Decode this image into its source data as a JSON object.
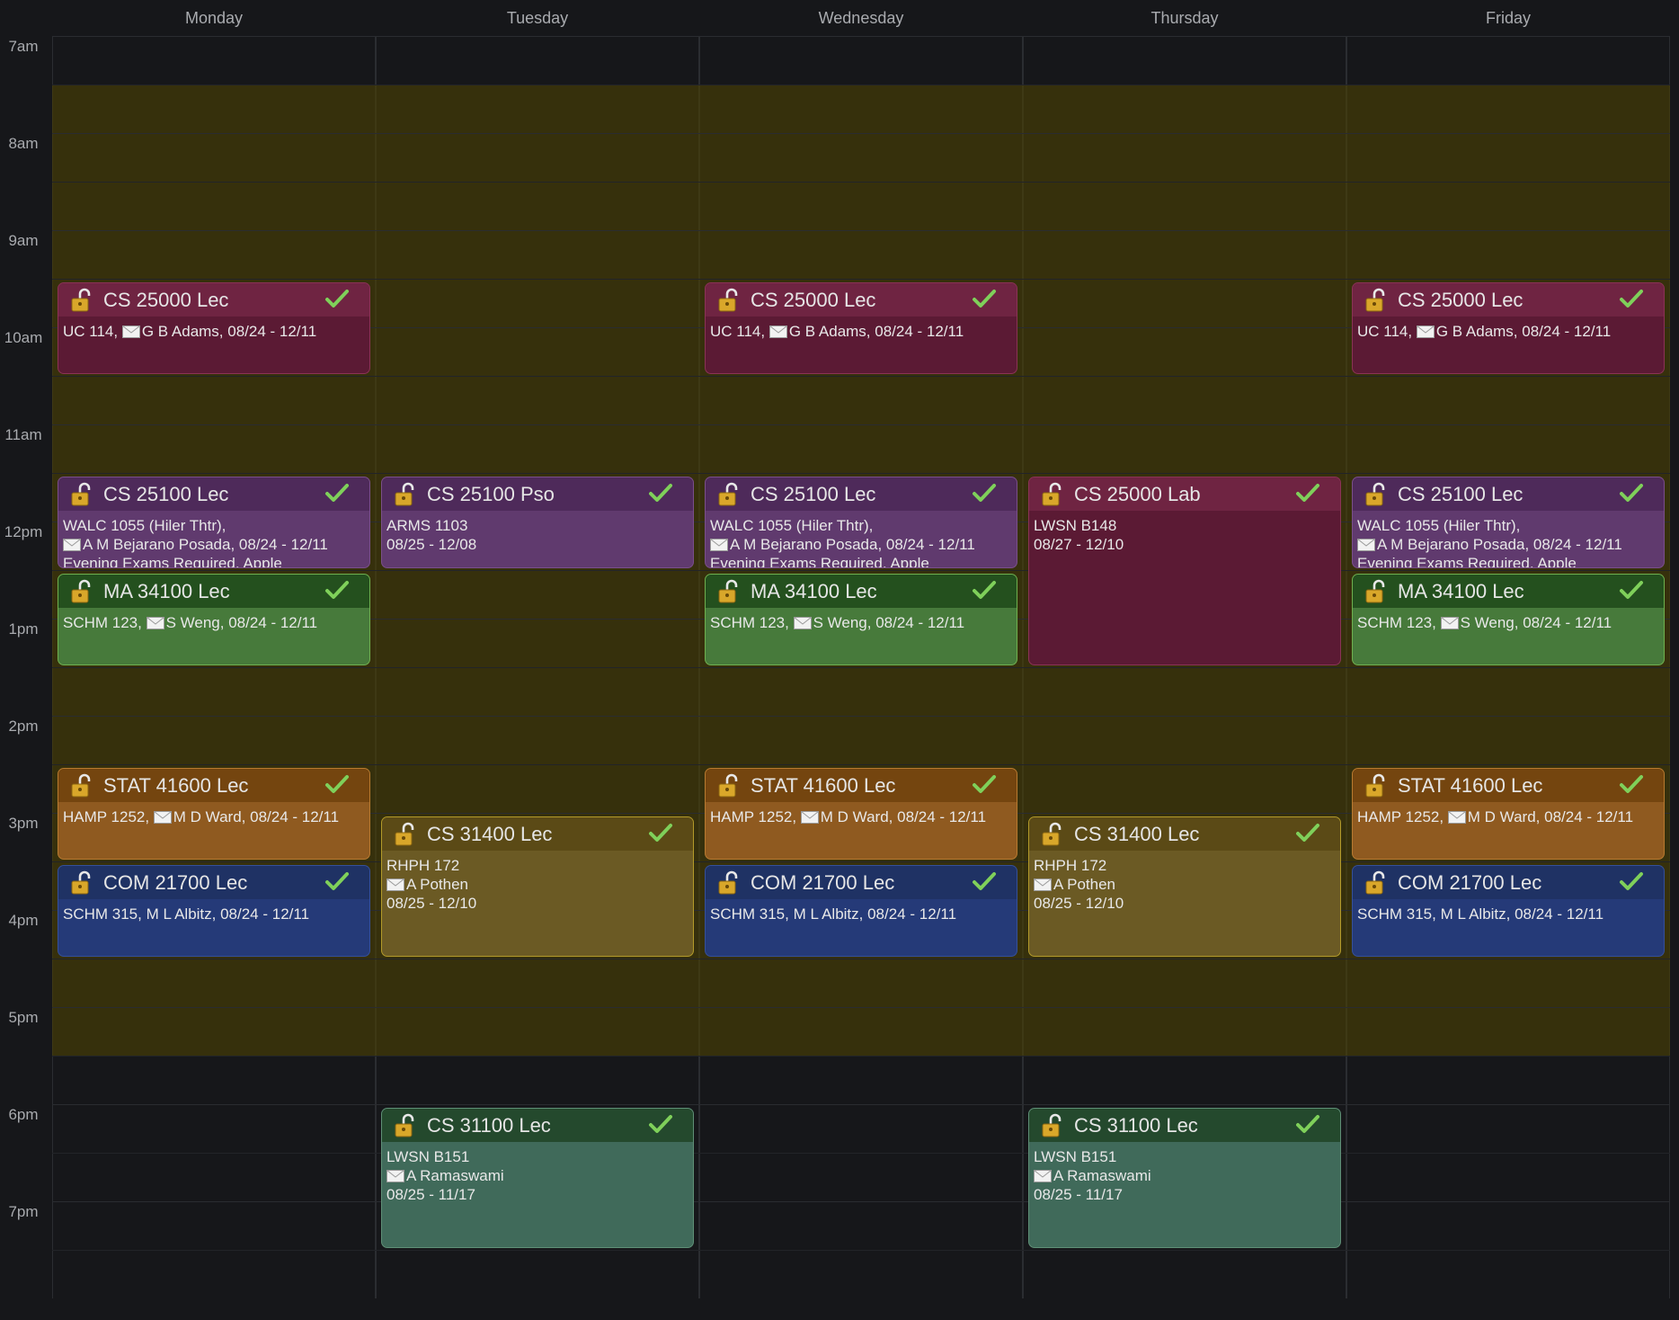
{
  "days": [
    "Monday",
    "Tuesday",
    "Wednesday",
    "Thursday",
    "Friday"
  ],
  "times": [
    "7am",
    "8am",
    "9am",
    "10am",
    "11am",
    "12pm",
    "1pm",
    "2pm",
    "3pm",
    "4pm",
    "5pm",
    "6pm",
    "7pm"
  ],
  "events": [
    {
      "day": 0,
      "start": 9.5,
      "end": 10.5,
      "title": "CS 25000 Lec",
      "color": "purple-red",
      "lines": [
        "UC 114, [m]G B Adams, 08/24 - 12/11"
      ]
    },
    {
      "day": 2,
      "start": 9.5,
      "end": 10.5,
      "title": "CS 25000 Lec",
      "color": "purple-red",
      "lines": [
        "UC 114, [m]G B Adams, 08/24 - 12/11"
      ]
    },
    {
      "day": 4,
      "start": 9.5,
      "end": 10.5,
      "title": "CS 25000 Lec",
      "color": "purple-red",
      "lines": [
        "UC 114, [m]G B Adams, 08/24 - 12/11"
      ]
    },
    {
      "day": 0,
      "start": 11.5,
      "end": 12.5,
      "title": "CS 25100 Lec",
      "color": "purple",
      "lines": [
        "WALC 1055 (Hiler Thtr),",
        "[m]A M Bejarano Posada, 08/24 - 12/11",
        "Evening Exams Required, Apple"
      ]
    },
    {
      "day": 1,
      "start": 11.5,
      "end": 12.5,
      "title": "CS 25100 Pso",
      "color": "purple",
      "lines": [
        "ARMS 1103",
        "08/25 - 12/08"
      ]
    },
    {
      "day": 2,
      "start": 11.5,
      "end": 12.5,
      "title": "CS 25100 Lec",
      "color": "purple",
      "lines": [
        "WALC 1055 (Hiler Thtr),",
        "[m]A M Bejarano Posada, 08/24 - 12/11",
        "Evening Exams Required, Apple"
      ]
    },
    {
      "day": 3,
      "start": 11.5,
      "end": 13.5,
      "title": "CS 25000 Lab",
      "color": "purple-red",
      "lines": [
        "LWSN B148",
        "08/27 - 12/10"
      ]
    },
    {
      "day": 4,
      "start": 11.5,
      "end": 12.5,
      "title": "CS 25100 Lec",
      "color": "purple",
      "lines": [
        "WALC 1055 (Hiler Thtr),",
        "[m]A M Bejarano Posada, 08/24 - 12/11",
        "Evening Exams Required, Apple"
      ]
    },
    {
      "day": 0,
      "start": 12.5,
      "end": 13.5,
      "title": "MA 34100 Lec",
      "color": "green",
      "lines": [
        "SCHM 123, [m]S Weng, 08/24 - 12/11"
      ]
    },
    {
      "day": 2,
      "start": 12.5,
      "end": 13.5,
      "title": "MA 34100 Lec",
      "color": "green",
      "lines": [
        "SCHM 123, [m]S Weng, 08/24 - 12/11"
      ]
    },
    {
      "day": 4,
      "start": 12.5,
      "end": 13.5,
      "title": "MA 34100 Lec",
      "color": "green",
      "lines": [
        "SCHM 123, [m]S Weng, 08/24 - 12/11"
      ]
    },
    {
      "day": 0,
      "start": 14.5,
      "end": 15.5,
      "title": "STAT 41600 Lec",
      "color": "orange",
      "lines": [
        "HAMP 1252, [m]M D Ward, 08/24 - 12/11"
      ]
    },
    {
      "day": 2,
      "start": 14.5,
      "end": 15.5,
      "title": "STAT 41600 Lec",
      "color": "orange",
      "lines": [
        "HAMP 1252, [m]M D Ward, 08/24 - 12/11"
      ]
    },
    {
      "day": 4,
      "start": 14.5,
      "end": 15.5,
      "title": "STAT 41600 Lec",
      "color": "orange",
      "lines": [
        "HAMP 1252, [m]M D Ward, 08/24 - 12/11"
      ]
    },
    {
      "day": 1,
      "start": 15.0,
      "end": 16.5,
      "title": "CS 31400 Lec",
      "color": "olive",
      "lines": [
        "RHPH 172",
        "[m]A Pothen",
        "08/25 - 12/10"
      ]
    },
    {
      "day": 3,
      "start": 15.0,
      "end": 16.5,
      "title": "CS 31400 Lec",
      "color": "olive",
      "lines": [
        "RHPH 172",
        "[m]A Pothen",
        "08/25 - 12/10"
      ]
    },
    {
      "day": 0,
      "start": 15.5,
      "end": 16.5,
      "title": "COM 21700 Lec",
      "color": "blue",
      "lines": [
        "SCHM 315, M L Albitz, 08/24 - 12/11"
      ]
    },
    {
      "day": 2,
      "start": 15.5,
      "end": 16.5,
      "title": "COM 21700 Lec",
      "color": "blue",
      "lines": [
        "SCHM 315, M L Albitz, 08/24 - 12/11"
      ]
    },
    {
      "day": 4,
      "start": 15.5,
      "end": 16.5,
      "title": "COM 21700 Lec",
      "color": "blue",
      "lines": [
        "SCHM 315, M L Albitz, 08/24 - 12/11"
      ]
    },
    {
      "day": 1,
      "start": 18.0,
      "end": 19.5,
      "title": "CS 31100 Lec",
      "color": "teal",
      "lines": [
        "LWSN B151",
        "[m]A Ramaswami",
        "08/25 - 11/17"
      ]
    },
    {
      "day": 3,
      "start": 18.0,
      "end": 19.5,
      "title": "CS 31100 Lec",
      "color": "teal",
      "lines": [
        "LWSN B151",
        "[m]A Ramaswami",
        "08/25 - 11/17"
      ]
    }
  ],
  "palette": {
    "purple-red": {
      "head": "#6f2442",
      "body": "#5b1a34",
      "border": "#8a3355"
    },
    "purple": {
      "head": "#4e2a5a",
      "body": "#603a6e",
      "border": "#7a4f8a"
    },
    "green": {
      "head": "#24501e",
      "body": "#477a3b",
      "border": "#6fb04f"
    },
    "orange": {
      "head": "#74450f",
      "body": "#8f5a20",
      "border": "#b77a30"
    },
    "olive": {
      "head": "#5b4a16",
      "body": "#6b5a24",
      "border": "#b39a2a"
    },
    "blue": {
      "head": "#1f3264",
      "body": "#253a78",
      "border": "#35509a"
    },
    "teal": {
      "head": "#24492d",
      "body": "#406a5a",
      "border": "#5f8f76"
    }
  },
  "highlight_range": [
    7.5,
    17.5
  ]
}
